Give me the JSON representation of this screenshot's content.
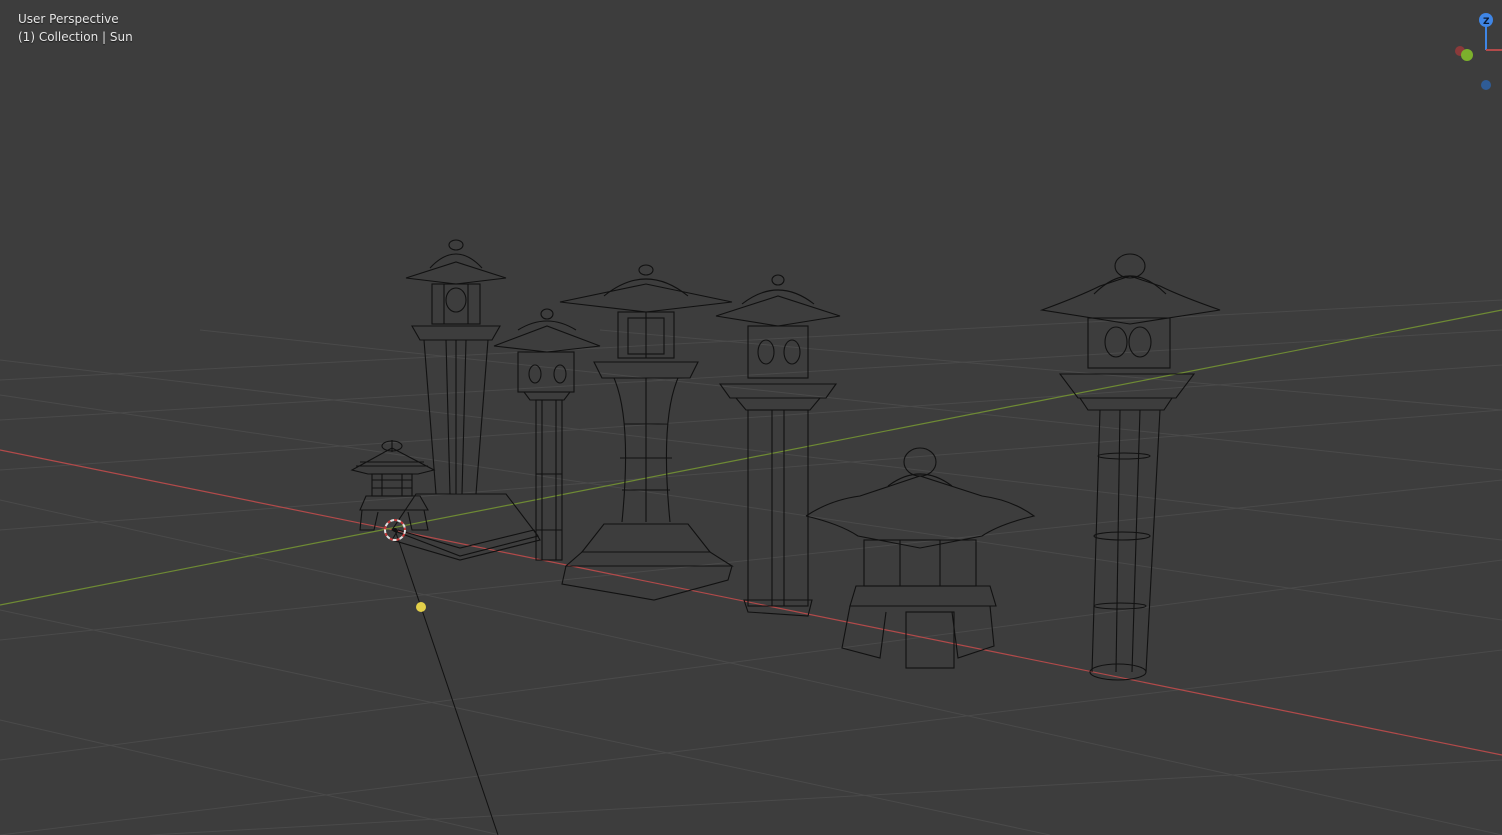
{
  "viewport": {
    "view_mode": "User Perspective",
    "collection_info": "(1) Collection | Sun"
  },
  "gizmo": {
    "z_label": "Z"
  },
  "colors": {
    "background": "#3d3d3d",
    "grid": "#4a4a4a",
    "x_axis": "#b24a4a",
    "y_axis": "#6e8a34",
    "wire": "#111111",
    "light": "#e3d04a",
    "z_axis": "#3f86e6"
  },
  "scene_objects": [
    "small-lantern",
    "tall-lantern-1",
    "slim-lantern",
    "central-lantern",
    "pillar-lantern",
    "squat-lantern",
    "tall-round-lantern",
    "sun-light",
    "3d-cursor"
  ]
}
